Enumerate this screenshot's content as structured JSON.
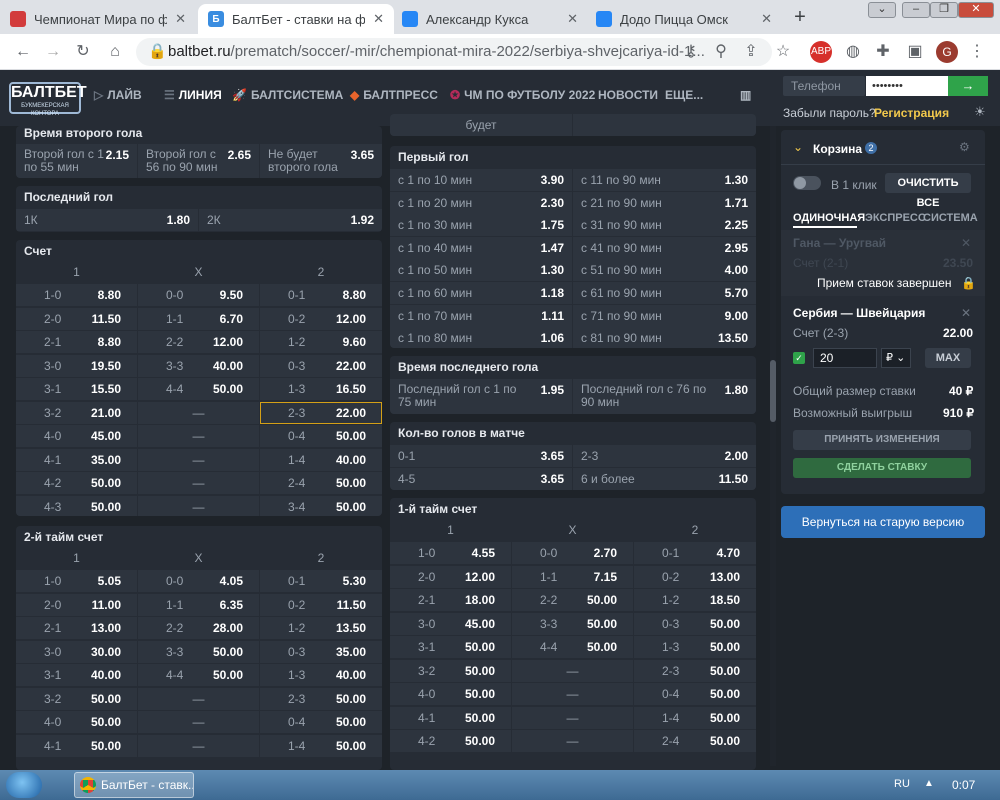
{
  "browser": {
    "tabs": [
      {
        "title": "Чемпионат Мира по фу",
        "icon": "site-icon",
        "color": "#d23c3c",
        "fav": "",
        "active": false
      },
      {
        "title": "БалтБет - ставки на футб",
        "icon": "baltbet-icon",
        "color": "#3a8de0",
        "fav": "Б",
        "active": true
      },
      {
        "title": "Александр Кукса",
        "icon": "vk-icon",
        "color": "#2787f5",
        "fav": "",
        "active": false
      },
      {
        "title": "Додо Пицца Омск",
        "icon": "vk-icon",
        "color": "#2787f5",
        "fav": "",
        "active": false
      }
    ],
    "new_tab": "+",
    "url_domain": "baltbet.ru",
    "url_path": "/prematch/soccer/-mir/chempionat-mira-2022/serbiya-shvejcariya-id-1...",
    "ext_badge": "ABP",
    "profile": "G"
  },
  "header": {
    "logo": "БАЛТБЕТ",
    "logo_sub": "БУКМЕКЕРСКАЯ КОНТОРА",
    "nav": [
      "ЛАЙВ",
      "ЛИНИЯ",
      "БАЛТСИСТЕМА",
      "БАЛТПРЕСС",
      "ЧМ ПО ФУТБОЛУ 2022",
      "НОВОСТИ",
      "ЕЩЕ..."
    ],
    "phone_placeholder": "Телефон",
    "password_mask": "••••••••",
    "login_arrow": "→",
    "forgot": "Забыли пароль?",
    "register": "Регистрация"
  },
  "left": {
    "second_goal_time": {
      "title": "Время второго гола",
      "cells": [
        {
          "label": "Второй гол с 1 по 55 мин",
          "value": "2.15"
        },
        {
          "label": "Второй гол с 56 по 90 мин",
          "value": "2.65"
        },
        {
          "label": "Не будет второго гола",
          "value": "3.65"
        }
      ]
    },
    "last_goal": {
      "title": "Последний гол",
      "cells": [
        {
          "label": "1К",
          "value": "1.80"
        },
        {
          "label": "2К",
          "value": "1.92"
        }
      ]
    },
    "score": {
      "title": "Счет",
      "headers": [
        "1",
        "X",
        "2"
      ],
      "rows": [
        [
          [
            "1-0",
            "8.80"
          ],
          [
            "0-0",
            "9.50"
          ],
          [
            "0-1",
            "8.80"
          ]
        ],
        [
          [
            "2-0",
            "11.50"
          ],
          [
            "1-1",
            "6.70"
          ],
          [
            "0-2",
            "12.00"
          ]
        ],
        [
          [
            "2-1",
            "8.80"
          ],
          [
            "2-2",
            "12.00"
          ],
          [
            "1-2",
            "9.60"
          ]
        ],
        [
          [
            "3-0",
            "19.50"
          ],
          [
            "3-3",
            "40.00"
          ],
          [
            "0-3",
            "22.00"
          ]
        ],
        [
          [
            "3-1",
            "15.50"
          ],
          [
            "4-4",
            "50.00"
          ],
          [
            "1-3",
            "16.50"
          ]
        ],
        [
          [
            "3-2",
            "21.00"
          ],
          [
            "—",
            ""
          ],
          [
            "2-3",
            "22.00"
          ]
        ],
        [
          [
            "4-0",
            "45.00"
          ],
          [
            "—",
            ""
          ],
          [
            "0-4",
            "50.00"
          ]
        ],
        [
          [
            "4-1",
            "35.00"
          ],
          [
            "—",
            ""
          ],
          [
            "1-4",
            "40.00"
          ]
        ],
        [
          [
            "4-2",
            "50.00"
          ],
          [
            "—",
            ""
          ],
          [
            "2-4",
            "50.00"
          ]
        ],
        [
          [
            "4-3",
            "50.00"
          ],
          [
            "—",
            ""
          ],
          [
            "3-4",
            "50.00"
          ]
        ]
      ]
    },
    "second_half_score": {
      "title": "2-й тайм счет",
      "headers": [
        "1",
        "X",
        "2"
      ],
      "rows": [
        [
          [
            "1-0",
            "5.05"
          ],
          [
            "0-0",
            "4.05"
          ],
          [
            "0-1",
            "5.30"
          ]
        ],
        [
          [
            "2-0",
            "11.00"
          ],
          [
            "1-1",
            "6.35"
          ],
          [
            "0-2",
            "11.50"
          ]
        ],
        [
          [
            "2-1",
            "13.00"
          ],
          [
            "2-2",
            "28.00"
          ],
          [
            "1-2",
            "13.50"
          ]
        ],
        [
          [
            "3-0",
            "30.00"
          ],
          [
            "3-3",
            "50.00"
          ],
          [
            "0-3",
            "35.00"
          ]
        ],
        [
          [
            "3-1",
            "40.00"
          ],
          [
            "4-4",
            "50.00"
          ],
          [
            "1-3",
            "40.00"
          ]
        ],
        [
          [
            "3-2",
            "50.00"
          ],
          [
            "—",
            ""
          ],
          [
            "2-3",
            "50.00"
          ]
        ],
        [
          [
            "4-0",
            "50.00"
          ],
          [
            "—",
            ""
          ],
          [
            "0-4",
            "50.00"
          ]
        ],
        [
          [
            "4-1",
            "50.00"
          ],
          [
            "—",
            ""
          ],
          [
            "1-4",
            "50.00"
          ]
        ]
      ]
    }
  },
  "mid": {
    "top_cut": "будет",
    "first_goal": {
      "title": "Первый гол",
      "rows": [
        [
          [
            "с 1 по 10 мин",
            "3.90"
          ],
          [
            "с 11 по 90 мин",
            "1.30"
          ]
        ],
        [
          [
            "с 1 по 20 мин",
            "2.30"
          ],
          [
            "с 21 по 90 мин",
            "1.71"
          ]
        ],
        [
          [
            "с 1 по 30 мин",
            "1.75"
          ],
          [
            "с 31 по 90 мин",
            "2.25"
          ]
        ],
        [
          [
            "с 1 по 40 мин",
            "1.47"
          ],
          [
            "с 41 по 90 мин",
            "2.95"
          ]
        ],
        [
          [
            "с 1 по 50 мин",
            "1.30"
          ],
          [
            "с 51 по 90 мин",
            "4.00"
          ]
        ],
        [
          [
            "с 1 по 60 мин",
            "1.18"
          ],
          [
            "с 61 по 90 мин",
            "5.70"
          ]
        ],
        [
          [
            "с 1 по 70 мин",
            "1.11"
          ],
          [
            "с 71 по 90 мин",
            "9.00"
          ]
        ],
        [
          [
            "с 1 по 80 мин",
            "1.06"
          ],
          [
            "с 81 по 90 мин",
            "13.50"
          ]
        ]
      ]
    },
    "last_goal_time": {
      "title": "Время последнего гола",
      "cells": [
        {
          "label": "Последний гол с 1 по 75 мин",
          "value": "1.95"
        },
        {
          "label": "Последний гол с 76 по 90 мин",
          "value": "1.80"
        }
      ]
    },
    "goals_count": {
      "title": "Кол-во голов в матче",
      "rows": [
        [
          [
            "0-1",
            "3.65"
          ],
          [
            "2-3",
            "2.00"
          ]
        ],
        [
          [
            "4-5",
            "3.65"
          ],
          [
            "6 и более",
            "11.50"
          ]
        ]
      ]
    },
    "first_half_score": {
      "title": "1-й тайм счет",
      "headers": [
        "1",
        "X",
        "2"
      ],
      "rows": [
        [
          [
            "1-0",
            "4.55"
          ],
          [
            "0-0",
            "2.70"
          ],
          [
            "0-1",
            "4.70"
          ]
        ],
        [
          [
            "2-0",
            "12.00"
          ],
          [
            "1-1",
            "7.15"
          ],
          [
            "0-2",
            "13.00"
          ]
        ],
        [
          [
            "2-1",
            "18.00"
          ],
          [
            "2-2",
            "50.00"
          ],
          [
            "1-2",
            "18.50"
          ]
        ],
        [
          [
            "3-0",
            "45.00"
          ],
          [
            "3-3",
            "50.00"
          ],
          [
            "0-3",
            "50.00"
          ]
        ],
        [
          [
            "3-1",
            "50.00"
          ],
          [
            "4-4",
            "50.00"
          ],
          [
            "1-3",
            "50.00"
          ]
        ],
        [
          [
            "3-2",
            "50.00"
          ],
          [
            "—",
            ""
          ],
          [
            "2-3",
            "50.00"
          ]
        ],
        [
          [
            "4-0",
            "50.00"
          ],
          [
            "—",
            ""
          ],
          [
            "0-4",
            "50.00"
          ]
        ],
        [
          [
            "4-1",
            "50.00"
          ],
          [
            "—",
            ""
          ],
          [
            "1-4",
            "50.00"
          ]
        ],
        [
          [
            "4-2",
            "50.00"
          ],
          [
            "—",
            ""
          ],
          [
            "2-4",
            "50.00"
          ]
        ]
      ]
    }
  },
  "coupon": {
    "title": "Корзина",
    "count": "2",
    "one_click": "В 1 клик",
    "clear": "ОЧИСТИТЬ ВСЕ",
    "tabs": [
      "ОДИНОЧНАЯ",
      "ЭКСПРЕСС",
      "СИСТЕМА"
    ],
    "closed_event": "Гана — Уругвай",
    "closed_market": "Счет (2-1)",
    "closed_value": "23.50",
    "closed_notice": "Прием ставок завершен",
    "event": "Сербия — Швейцария",
    "market": "Счет (2-3)",
    "odds": "22.00",
    "stake": "20",
    "currency": "₽",
    "max": "MAX",
    "total_label": "Общий размер ставки",
    "total_value": "40 ₽",
    "win_label": "Возможный выигрыш",
    "win_value": "910 ₽",
    "accept": "ПРИНЯТЬ ИЗМЕНЕНИЯ",
    "place": "СДЕЛАТЬ СТАВКУ",
    "old_version": "Вернуться на старую версию"
  },
  "taskbar": {
    "app": "БалтБет - ставк...",
    "lang": "RU",
    "time": "0:07"
  },
  "colors": {
    "accent": "#f2c94c",
    "green": "#2fa34a",
    "blue": "#2d6fb8"
  }
}
